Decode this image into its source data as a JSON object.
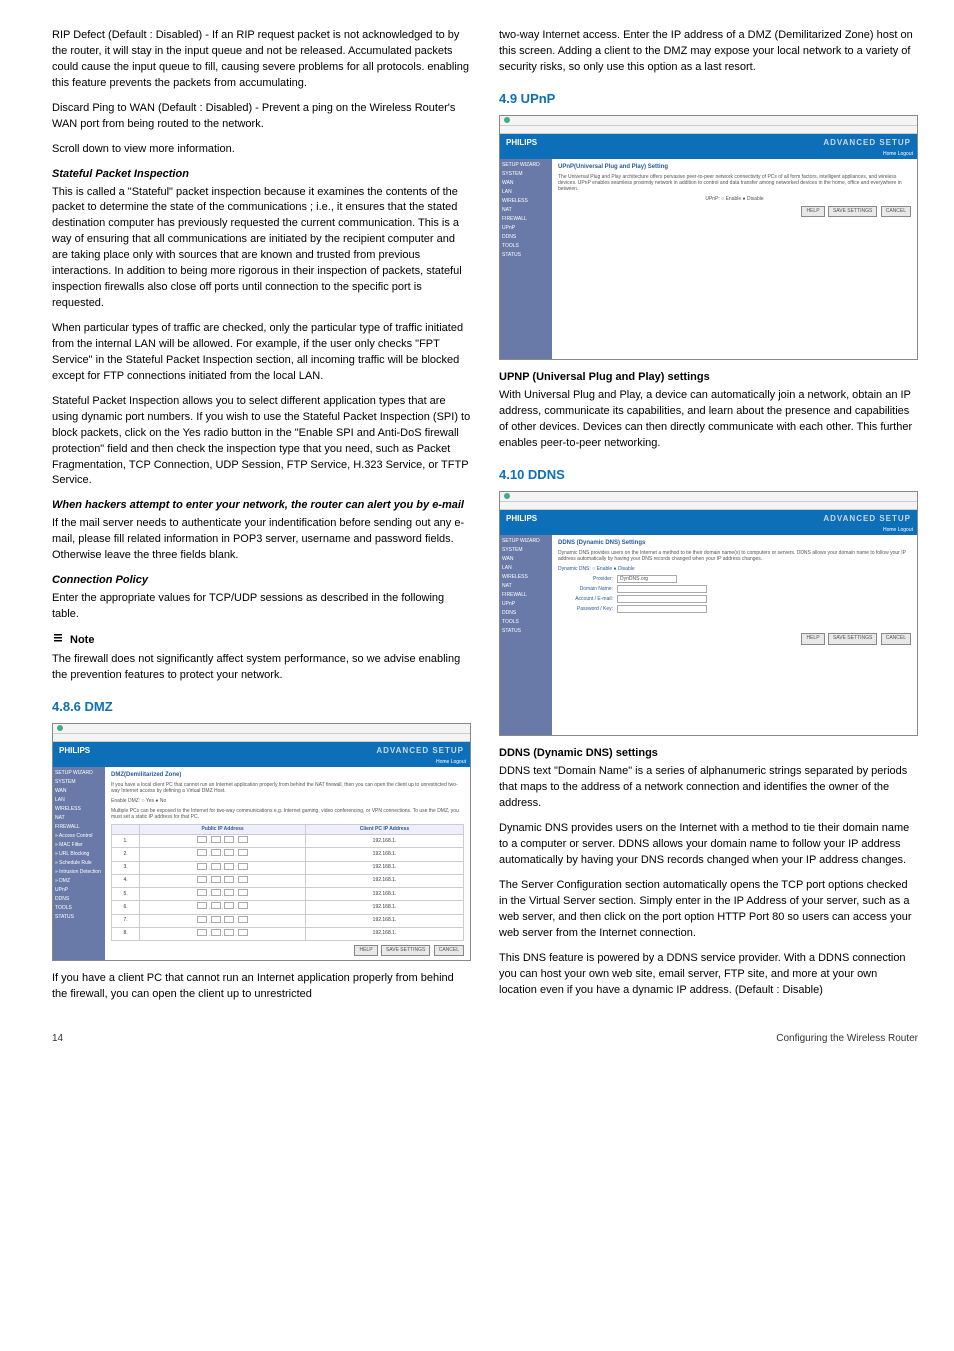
{
  "left": {
    "p1": "RIP Defect (Default : Disabled) - If an RIP request packet is not acknowledged to by the router, it will stay in the input queue and not be released. Accumulated packets could cause the input queue to fill, causing severe problems for all protocols. enabling this feature prevents the packets from accumulating.",
    "p2": "Discard Ping to WAN (Default : Disabled) - Prevent a ping on the Wireless Router's WAN port from being routed to the network.",
    "p3": "Scroll down to view more information.",
    "h_spi": "Stateful Packet Inspection",
    "spi1": "This is called a \"Stateful\" packet inspection because it examines the contents of the packet to determine the state of the communications ; i.e., it ensures that the stated destination computer has previously requested the current communication. This is a way of ensuring that all communications are initiated by the recipient computer and are taking place only with sources that are known and trusted from previous interactions. In addition to being more rigorous in their inspection of packets, stateful inspection firewalls also close off ports until connection to the specific port is requested.",
    "spi2": "When particular types of traffic are checked, only the particular type of traffic initiated from the internal LAN will be allowed. For example, if the user only checks \"FPT Service\" in the Stateful Packet Inspection section, all incoming traffic will be blocked except for FTP connections initiated from the local LAN.",
    "spi3": "Stateful Packet Inspection allows you to select different application types that are using dynamic port numbers. If you wish to use the Stateful Packet Inspection (SPI) to block packets, click on the Yes radio button in the \"Enable SPI and Anti-DoS firewall protection\" field and then check the inspection type that you need, such as Packet Fragmentation, TCP Connection, UDP Session, FTP Service, H.323 Service, or TFTP Service.",
    "h_hack": "When hackers attempt to enter your network, the router can alert you by e-mail",
    "hack1": "If the mail server needs to authenticate your indentification before sending out any e-mail, please fill related information in POP3 server, username and password fields. Otherwise leave the three fields blank.",
    "h_conn": "Connection Policy",
    "conn1": "Enter the appropriate values for TCP/UDP sessions as described in the following table.",
    "note_label": "Note",
    "note1": "The firewall does not significantly affect system performance, so we advise enabling the prevention features to protect your network.",
    "h486": "4.8.6   DMZ",
    "dmz_caption": "If you have a client PC that cannot run an Internet application properly from behind the firewall, you can open the client up to unrestricted"
  },
  "right": {
    "p1": "two-way Internet access. Enter the IP address of a DMZ (Demilitarized Zone) host on this screen. Adding a client to the DMZ may expose your local network to a variety of security risks, so only use this option as a last resort.",
    "h49": "4.9    UPnP",
    "h_upnp": "UPNP (Universal Plug and Play) settings",
    "upnp1": "With Universal Plug and Play, a device can automatically join a network, obtain an IP address, communicate its capabilities, and learn about the presence and capabilities of other devices. Devices can then directly communicate with each other. This further enables peer-to-peer networking.",
    "h410": "4.10 DDNS",
    "h_ddns": "DDNS (Dynamic DNS) settings",
    "ddns1": "DDNS text \"Domain Name\" is a series of alphanumeric strings separated by periods that maps to the address of a network connection and identifies the owner of the address.",
    "ddns2": "Dynamic DNS provides users on the Internet with a method to tie their domain name to a computer or server. DDNS allows your domain name to follow your IP address automatically by having your DNS records changed when your IP address changes.",
    "ddns3": "The Server Configuration section automatically opens the TCP port options checked in the Virtual Server section. Simply enter in the IP Address of your server, such as a web server, and then click on the port option HTTP Port 80 so users can access your web server from the Internet connection.",
    "ddns4": "This DNS feature is powered by a DDNS service provider. With a DDNS connection you can host your own web site, email server, FTP site, and more at your own location even if you have a dynamic IP address. (Default : Disable)"
  },
  "shots": {
    "brand": "PHILIPS",
    "adv": "ADVANCED SETUP",
    "tabs": "Home  Logout",
    "sidebar_full": [
      "SETUP WIZARD",
      "SYSTEM",
      "WAN",
      "LAN",
      "WIRELESS",
      "NAT",
      "FIREWALL",
      "» Access Control",
      "» MAC Filter",
      "» URL Blocking",
      "» Schedule Rule",
      "» Intrusion Detection",
      "» DMZ",
      "UPnP",
      "DDNS",
      "TOOLS",
      "STATUS"
    ],
    "sidebar_short": [
      "SETUP WIZARD",
      "SYSTEM",
      "WAN",
      "LAN",
      "WIRELESS",
      "NAT",
      "FIREWALL",
      "UPnP",
      "DDNS",
      "TOOLS",
      "STATUS"
    ],
    "dmz": {
      "title": "DMZ(Demilitarized Zone)",
      "desc1": "If you have a local client PC that cannot run an Internet application properly from behind the NAT firewall, then you can open the client up to unrestricted two-way Internet access by defining a Virtual DMZ Host.",
      "enable": "Enable DMZ:   ○ Yes   ● No",
      "desc2": "Multiple PCs can be exposed to the Internet for two-way communications e.g. Internet gaming, video conferencing, or VPN connections. To use the DMZ, you must set a static IP address for that PC.",
      "th1": "Public IP Address",
      "th2": "Client PC IP Address",
      "row_ip": "192.168.1.",
      "btn_help": "HELP",
      "btn_save": "SAVE SETTINGS",
      "btn_cancel": "CANCEL"
    },
    "upnp": {
      "title": "UPnP(Universal Plug and Play) Setting",
      "desc": "The Universal Plug and Play architecture offers pervasive peer-to-peer network connectivity of PCs of all form factors, intelligent appliances, and wireless devices. UPnP enables seamless proximity network in addition to control and data transfer among networked devices in the home, office and everywhere in between.",
      "field": "UPnP:   ○ Enable   ● Disable",
      "btn_help": "HELP",
      "btn_save": "SAVE SETTINGS",
      "btn_cancel": "CANCEL"
    },
    "ddns": {
      "title": "DDNS (Dynamic DNS) Settings",
      "desc": "Dynamic DNS provides users on the Internet a method to tie their domain name(s) to computers or servers. DDNS allows your domain name to follow your IP address automatically by having your DNS records changed when your IP address changes.",
      "f1": "Dynamic DNS:   ○ Enable   ● Disable",
      "f2_l": "Provider:",
      "f2_v": "DynDNS.org",
      "f3_l": "Domain Name:",
      "f4_l": "Account / E-mail:",
      "f5_l": "Password / Key:",
      "btn_help": "HELP",
      "btn_save": "SAVE SETTINGS",
      "btn_cancel": "CANCEL"
    }
  },
  "footer": {
    "page": "14",
    "title": "Configuring the Wireless Router"
  }
}
